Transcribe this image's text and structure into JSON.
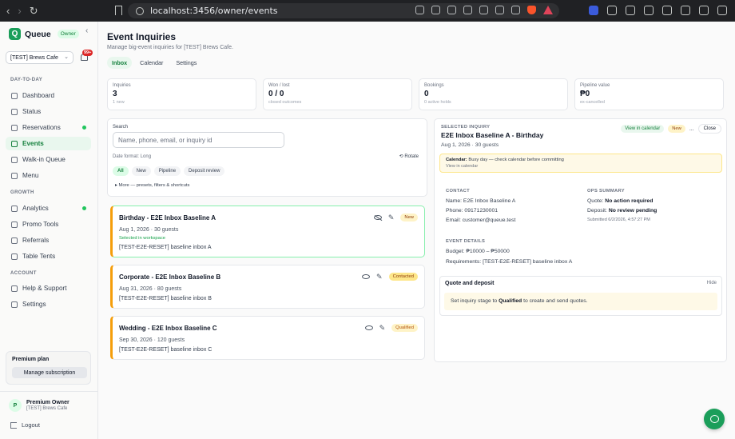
{
  "browser": {
    "url": "localhost:3456/owner/events"
  },
  "sidebar": {
    "brand": "Queue",
    "brand_badge": "Owner",
    "workspace": "[TEST] Brews Cafe",
    "notifications": "99+",
    "sections": {
      "day_to_day": "DAY-TO-DAY",
      "growth": "GROWTH",
      "account": "ACCOUNT"
    },
    "items": [
      {
        "label": "Dashboard"
      },
      {
        "label": "Status"
      },
      {
        "label": "Reservations"
      },
      {
        "label": "Events"
      },
      {
        "label": "Walk-in Queue"
      },
      {
        "label": "Menu"
      },
      {
        "label": "Analytics"
      },
      {
        "label": "Promo Tools"
      },
      {
        "label": "Referrals"
      },
      {
        "label": "Table Tents"
      },
      {
        "label": "Help & Support"
      },
      {
        "label": "Settings"
      }
    ],
    "premium": {
      "title": "Premium plan",
      "button": "Manage subscription"
    },
    "user": {
      "initial": "P",
      "name": "Premium Owner",
      "workspace": "[TEST] Brews Cafe"
    },
    "logout": "Logout"
  },
  "main": {
    "title": "Event Inquiries",
    "subtitle": "Manage big-event inquiries for [TEST] Brews Cafe.",
    "tabs": [
      "Inbox",
      "Calendar",
      "Settings"
    ],
    "stats": [
      {
        "label": "Inquiries",
        "value": "3",
        "sub": "1 new"
      },
      {
        "label": "Won / lost",
        "value": "0 / 0",
        "sub": "closed outcomes"
      },
      {
        "label": "Bookings",
        "value": "0",
        "sub": "0 active holds"
      },
      {
        "label": "Pipeline value",
        "value": "₱0",
        "sub": "ex-cancelled"
      }
    ],
    "search": {
      "label": "Search",
      "placeholder": "Name, phone, email, or inquiry id",
      "date_format": "Date format: Long",
      "rotate": "Rotate",
      "chips": [
        "All",
        "New",
        "Pipeline",
        "Deposit review"
      ],
      "more": "▸ More — presets, filters & shortcuts"
    },
    "inquiries": [
      {
        "title": "Birthday - E2E Inbox Baseline A",
        "details": "Aug 1, 2026 · 30 guests",
        "selected_note": "Selected in workspace",
        "note": "[TEST-E2E-RESET] baseline inbox A",
        "status": "New"
      },
      {
        "title": "Corporate - E2E Inbox Baseline B",
        "details": "Aug 31, 2026 · 80 guests",
        "note": "[TEST-E2E-RESET] baseline inbox B",
        "status": "Contacted"
      },
      {
        "title": "Wedding - E2E Inbox Baseline C",
        "details": "Sep 30, 2026 · 120 guests",
        "note": "[TEST-E2E-RESET] baseline inbox C",
        "status": "Qualified"
      }
    ],
    "detail": {
      "label": "SELECTED INQUIRY",
      "title": "E2E Inbox Baseline A - Birthday",
      "meta": "Aug 1, 2026 · 30 guests",
      "view_calendar": "View in calendar",
      "status": "New",
      "more": "...",
      "close": "Close",
      "alert_label": "Calendar:",
      "alert_text": "Busy day — check calendar before committing",
      "alert_link": "View in calendar",
      "contact_label": "CONTACT",
      "name": "Name: E2E Inbox Baseline A",
      "phone": "Phone: 09171230001",
      "email": "Email: customer@queue.test",
      "ops_label": "OPS SUMMARY",
      "quote_key": "Quote:",
      "quote_val": "No action required",
      "deposit_key": "Deposit:",
      "deposit_val": "No review pending",
      "submitted": "Submitted 6/2/2026, 4:57:27 PM",
      "event_label": "EVENT DETAILS",
      "budget": "Budget: ₱10000 – ₱50000",
      "requirements": "Requirements: [TEST-E2E-RESET] baseline inbox A",
      "quote_title": "Quote and deposit",
      "hide": "Hide",
      "quote_msg_a": "Set inquiry stage to",
      "quote_msg_b": "Qualified",
      "quote_msg_c": "to create and send quotes."
    }
  }
}
